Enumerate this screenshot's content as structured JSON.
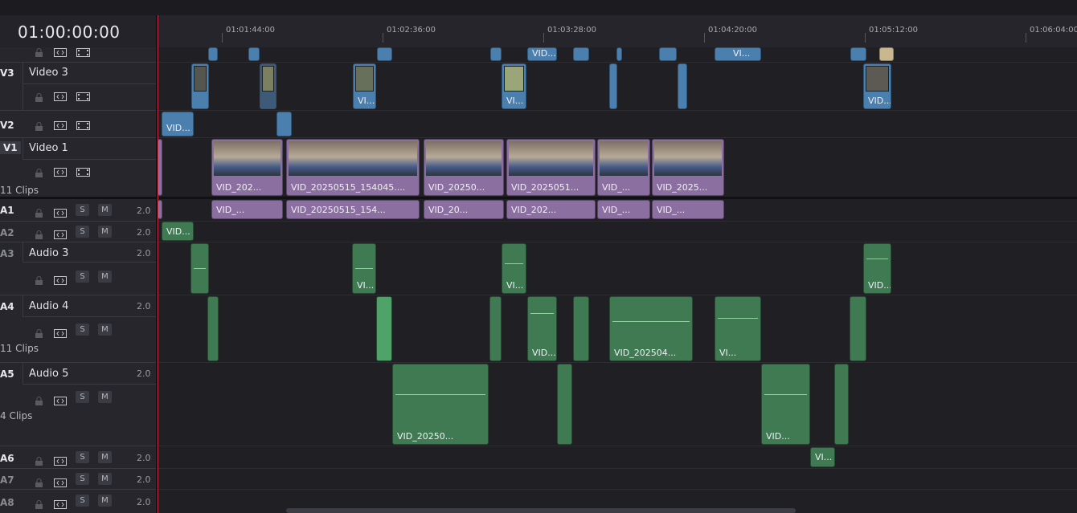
{
  "timecode": "01:00:00:00",
  "ruler_labels": [
    "01:01:44:00",
    "01:02:36:00",
    "01:03:28:00",
    "01:04:20:00",
    "01:05:12:00",
    "01:06:04:00"
  ],
  "tracks": {
    "v3": {
      "id": "V3",
      "name": "Video 3"
    },
    "v2": {
      "id": "V2"
    },
    "v1": {
      "id": "V1",
      "name": "Video 1",
      "clips": "11 Clips"
    },
    "a1": {
      "id": "A1",
      "vol": "2.0"
    },
    "a2": {
      "id": "A2",
      "vol": "2.0"
    },
    "a3": {
      "id": "A3",
      "name": "Audio 3",
      "vol": "2.0"
    },
    "a4": {
      "id": "A4",
      "name": "Audio 4",
      "vol": "2.0",
      "clips": "11 Clips"
    },
    "a5": {
      "id": "A5",
      "name": "Audio 5",
      "vol": "2.0",
      "clips": "4 Clips"
    },
    "a6": {
      "id": "A6",
      "vol": "2.0"
    },
    "a7": {
      "id": "A7",
      "vol": "2.0"
    },
    "a8": {
      "id": "A8",
      "vol": "2.0"
    }
  },
  "buttons": {
    "solo": "S",
    "mute": "M"
  },
  "clips": {
    "v4_1": "VID...",
    "v4_2": "VI...",
    "v3_1": "VI...",
    "v3_2": "VI...",
    "v3_3": "VID...",
    "v2_1": "VID...",
    "v1_1": "VID_202...",
    "v1_2": "VID_20250515_154045....",
    "v1_3": "VID_20250...",
    "v1_4": "VID_2025051...",
    "v1_5": "VID_...",
    "v1_6": "VID_2025...",
    "a1_1": "VID_...",
    "a1_2": "VID_20250515_154...",
    "a1_3": "VID_20...",
    "a1_4": "VID_202...",
    "a1_5": "VID_...",
    "a1_6": "VID_...",
    "a2_1": "VID...",
    "a3_1": "VI...",
    "a3_2": "VI...",
    "a3_3": "VID...",
    "a4_1": "VID...",
    "a4_2": "VID_202504...",
    "a4_3": "VI...",
    "a5_1": "VID_20250...",
    "a5_2": "VID...",
    "a6_1": "VI..."
  },
  "colors": {
    "video": "#4a7fae",
    "video1": "#8c6fa1",
    "audio": "#3f7a52",
    "playhead": "#c8334a"
  }
}
